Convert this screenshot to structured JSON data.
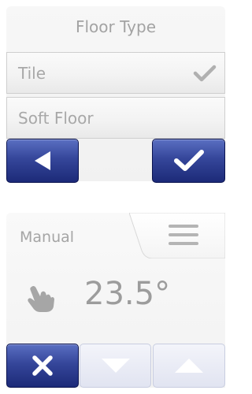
{
  "floor_type_screen": {
    "title": "Floor Type",
    "options": [
      {
        "label": "Tile",
        "selected": true,
        "icon": "check-icon"
      },
      {
        "label": "Soft Floor",
        "selected": false
      }
    ],
    "buttons": {
      "back_icon": "triangle-left-icon",
      "confirm_icon": "check-icon"
    }
  },
  "manual_screen": {
    "mode_label": "Manual",
    "menu_icon": "hamburger-menu-icon",
    "mode_icon": "hand-icon",
    "temperature": "23.5°",
    "buttons": {
      "cancel_icon": "x-icon",
      "down_icon": "triangle-down-icon",
      "up_icon": "triangle-up-icon"
    }
  },
  "colors": {
    "button_blue": "#1c2a78",
    "button_blue_light": "#5a6fc2",
    "disabled_button": "#e1e4f1",
    "text_gray": "#a5a5a5"
  }
}
